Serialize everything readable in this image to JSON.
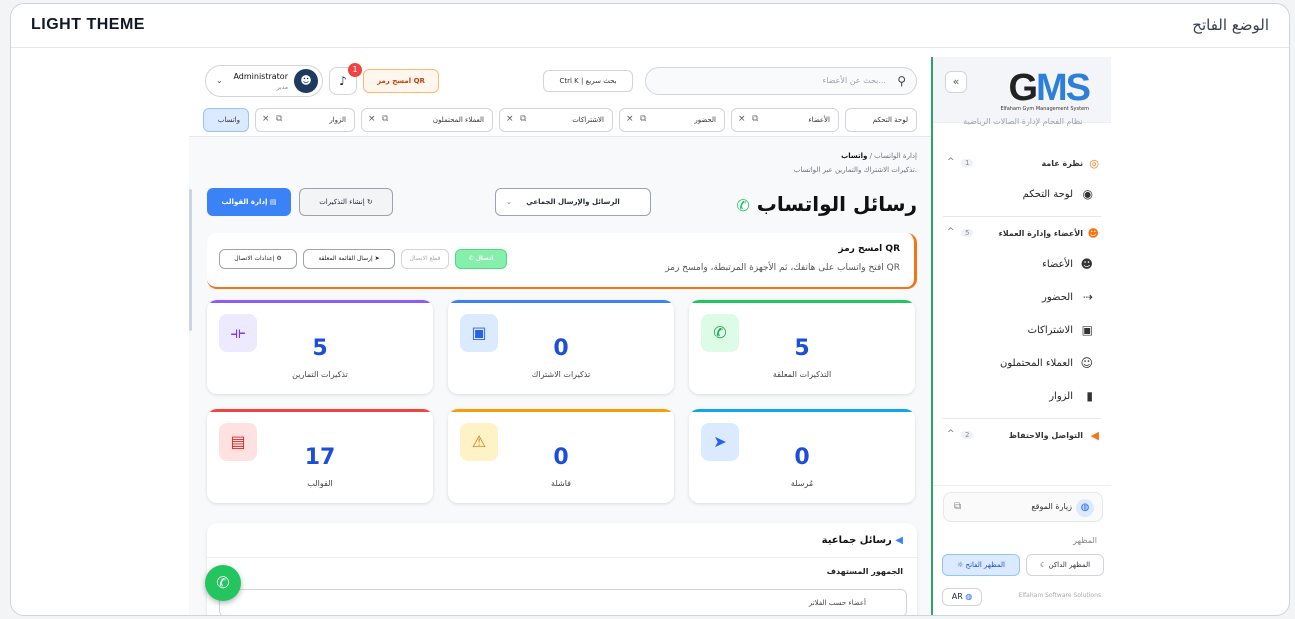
{
  "top": {
    "left_label": "LIGHT THEME",
    "right_label": "الوضع الفاتح"
  },
  "sidebar": {
    "logo_text": "GMS",
    "logo_small": "Elfaham Gym Management System",
    "logo_sub": "نظام الفحام لإدارة الصالات الرياضية",
    "collapse_icon": "«",
    "sections": [
      {
        "label": "نظرة عامة",
        "count": "1"
      },
      {
        "label": "الأعضاء وإدارة العملاء",
        "count": "5"
      },
      {
        "label": "التواصل والاحتفاظ",
        "count": "2"
      }
    ],
    "items": [
      {
        "label": "لوحة التحكم"
      },
      {
        "label": "الأعضاء"
      },
      {
        "label": "الحضور"
      },
      {
        "label": "الاشتراكات"
      },
      {
        "label": "العملاء المحتملون"
      },
      {
        "label": "الزوار"
      }
    ],
    "visit_label": "زيارة الموقع",
    "appearance_label": "المظهر",
    "light_label": "المظهر الفاتح",
    "dark_label": "المظهر الداكن",
    "lang_label": "AR",
    "brand_label": "Elfaham Software Solutions"
  },
  "header": {
    "search_placeholder": "بحث عن الأعضاء...",
    "quick_search": "Ctrl K | بحث سريع",
    "qr_button": "امسح رمز QR",
    "notif_count": "1",
    "user_name": "Administrator",
    "user_role": "مدير"
  },
  "tabs": [
    {
      "label": "لوحة التحكم"
    },
    {
      "label": "الأعضاء"
    },
    {
      "label": "الحضور"
    },
    {
      "label": "الاشتراكات"
    },
    {
      "label": "العملاء المحتملون"
    },
    {
      "label": "الزوار"
    },
    {
      "label": "واتساب"
    }
  ],
  "page": {
    "breadcrumb_root": "إدارة الواتساب",
    "breadcrumb_sep": "/",
    "breadcrumb_current": "واتساب",
    "subtitle": "تذكيرات الاشتراك والتمارين عبر الواتساب.",
    "title": "رسائل الواتساب",
    "select_value": "الرسائل والإرسال الجماعي",
    "remind_button": "إنشاء التذكيرات",
    "templates_button": "إدارة القوالب"
  },
  "qr_panel": {
    "heading": "امسح رمز QR",
    "desc": "افتح واتساب على هاتفك، ثم الأجهزة المرتبطة، وامسح رمز QR",
    "connect": "اتصال",
    "disconnect": "قطع الاتصال",
    "send_pending": "إرسال القائمة المعلقة",
    "settings": "إعدادات الاتصال"
  },
  "stats": [
    {
      "value": "5",
      "label": "التذكيرات المعلقة",
      "color": "#22c55e"
    },
    {
      "value": "0",
      "label": "تذكيرات الاشتراك",
      "color": "#3b82f6"
    },
    {
      "value": "5",
      "label": "تذكيرات التمارين",
      "color": "#8b5cf6"
    },
    {
      "value": "0",
      "label": "مُرسلة",
      "color": "#0ea5e9"
    },
    {
      "value": "0",
      "label": "فاشلة",
      "color": "#f59e0b"
    },
    {
      "value": "17",
      "label": "القوالب",
      "color": "#ef4444"
    }
  ],
  "bulk": {
    "heading": "رسائل جماعية",
    "audience_label": "الجمهور المستهدف",
    "audience_value": "أعضاء حسب الفلاتر"
  }
}
